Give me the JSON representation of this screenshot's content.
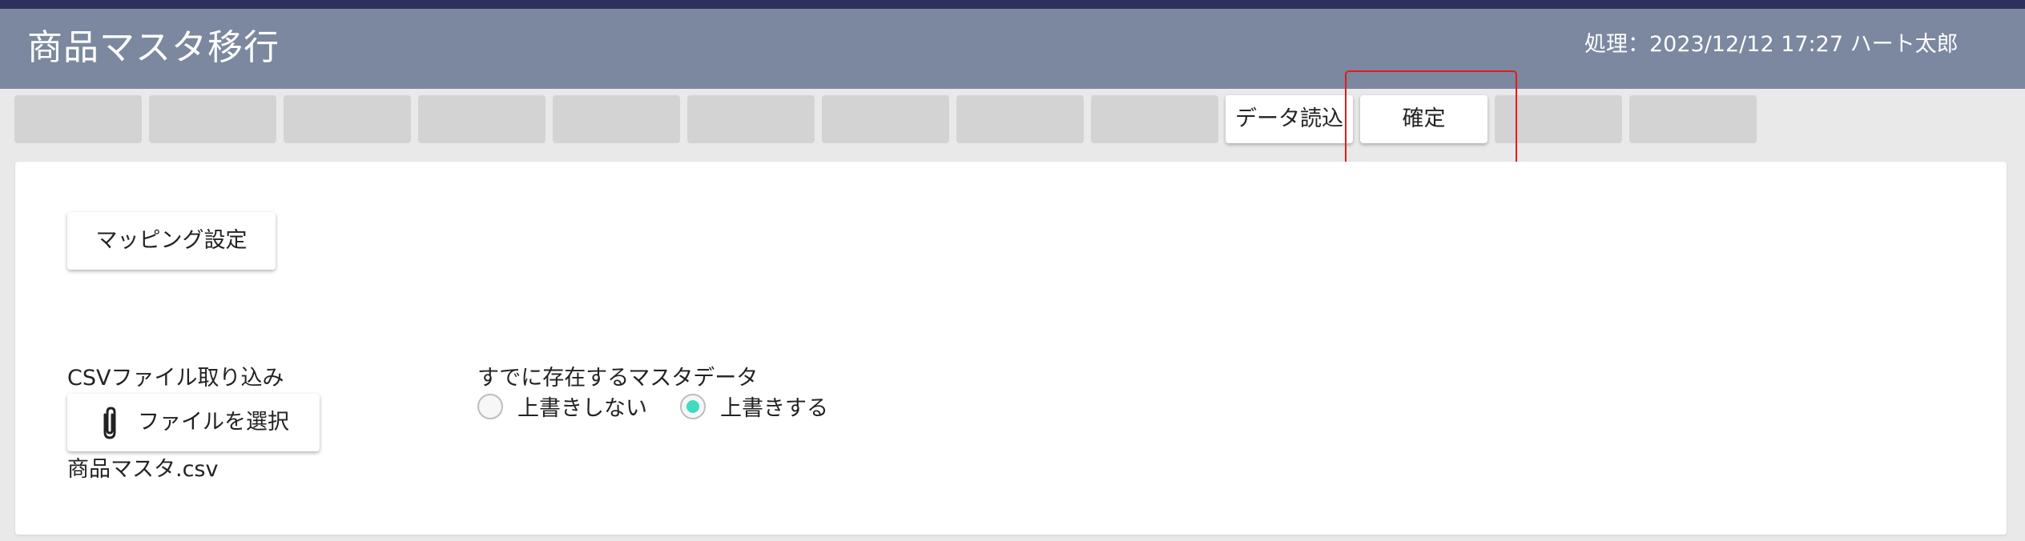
{
  "header": {
    "title": "商品マスタ移行",
    "process_info": "処理：2023/12/12 17:27 ハート太郎"
  },
  "toolbar": {
    "buttons": [
      {
        "label": ""
      },
      {
        "label": ""
      },
      {
        "label": ""
      },
      {
        "label": ""
      },
      {
        "label": ""
      },
      {
        "label": ""
      },
      {
        "label": ""
      },
      {
        "label": ""
      },
      {
        "label": ""
      },
      {
        "label": "データ読込"
      },
      {
        "label": "確定"
      },
      {
        "label": ""
      },
      {
        "label": ""
      }
    ]
  },
  "main": {
    "mapping_button": "マッピング設定",
    "csv_label": "CSVファイル取り込み",
    "file_button": "ファイルを選択",
    "file_name": "商品マスタ.csv",
    "existing_label": "すでに存在するマスタデータ",
    "radio_options": [
      {
        "label": "上書きしない",
        "selected": false
      },
      {
        "label": "上書きする",
        "selected": true
      }
    ]
  },
  "colors": {
    "header_bg": "#7b889f",
    "top_line": "#2d2f5c",
    "radio_selected": "#3ddcc0",
    "highlight_border": "#e21b1b"
  },
  "icons": {
    "attach": "paperclip-icon"
  }
}
